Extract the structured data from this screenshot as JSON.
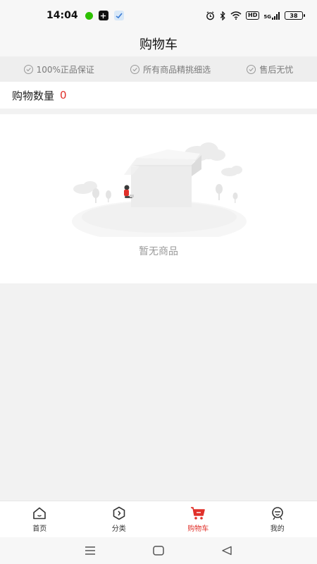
{
  "status": {
    "time": "14:04",
    "battery": "38",
    "hd": "HD",
    "signal_label": "5G"
  },
  "header": {
    "title": "购物车"
  },
  "guarantees": [
    {
      "label": "100%正品保证",
      "icon": "check-circle-icon"
    },
    {
      "label": "所有商品精挑细选",
      "icon": "check-circle-icon"
    },
    {
      "label": "售后无忧",
      "icon": "check-circle-icon"
    }
  ],
  "cart": {
    "count_label": "购物数量",
    "count_value": "0",
    "empty_text": "暂无商品"
  },
  "tabs": [
    {
      "label": "首页",
      "icon": "home-icon",
      "active": false
    },
    {
      "label": "分类",
      "icon": "category-icon",
      "active": false
    },
    {
      "label": "购物车",
      "icon": "cart-icon",
      "active": true
    },
    {
      "label": "我的",
      "icon": "profile-icon",
      "active": false
    }
  ],
  "colors": {
    "accent": "#e0302a",
    "muted_text": "#9a9a9a",
    "background": "#f2f2f2"
  }
}
